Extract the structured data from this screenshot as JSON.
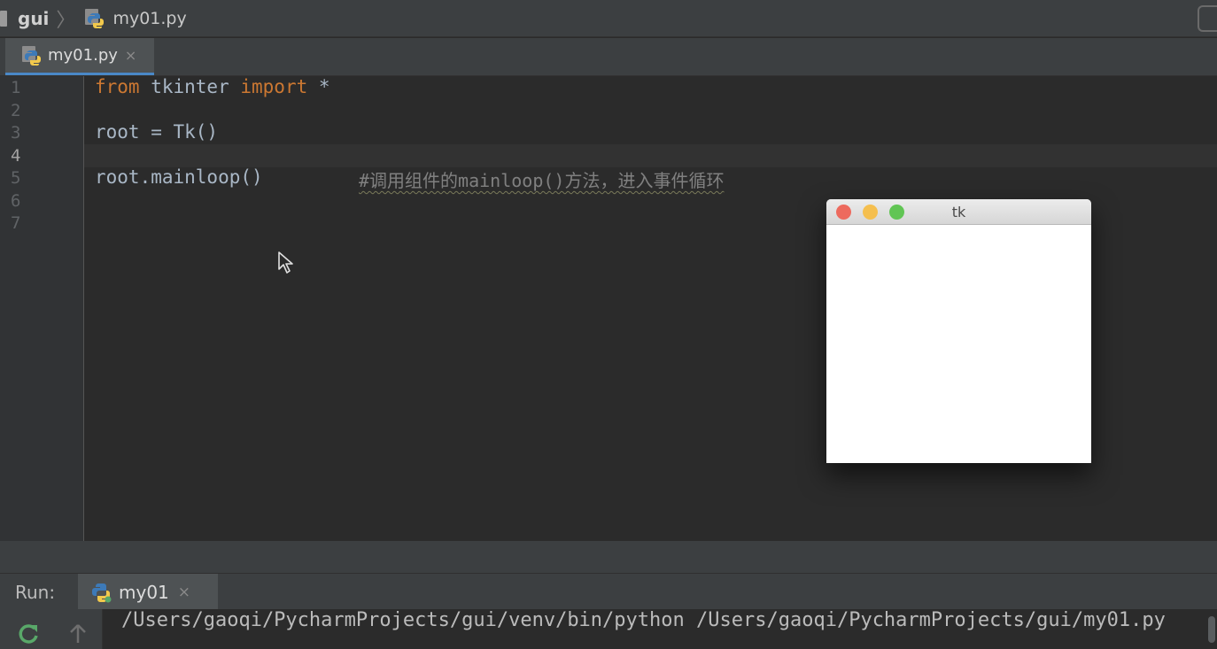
{
  "navbar": {
    "folder": "gui",
    "separator": "〉",
    "file": "my01.py",
    "file_icon": "python-file-icon"
  },
  "tabs": [
    {
      "label": "my01.py",
      "close": "×",
      "icon": "python-file-icon",
      "active": true
    }
  ],
  "editor": {
    "line_numbers": [
      "1",
      "2",
      "3",
      "4",
      "5",
      "6",
      "7"
    ],
    "current_line": "4",
    "code": {
      "line1": {
        "kw1": "from",
        "mod": " tkinter ",
        "kw2": "import",
        "rest": " *"
      },
      "line3": "root = Tk()",
      "line5_code": "root.mainloop()",
      "line5_comment": "#调用组件的mainloop()方法，进入事件循环"
    },
    "colors": {
      "keyword": "#cc7832",
      "text": "#a9b7c6",
      "comment": "#808080"
    }
  },
  "tk_window": {
    "title": "tk",
    "buttons": [
      "close",
      "minimize",
      "maximize"
    ]
  },
  "run_panel": {
    "label": "Run:",
    "tab_label": "my01",
    "tab_close": "×",
    "tab_icon": "python-run-icon",
    "console_line": "/Users/gaoqi/PycharmProjects/gui/venv/bin/python /Users/gaoqi/PycharmProjects/gui/my01.py",
    "tools": [
      "rerun-icon",
      "scroll-up-icon"
    ]
  }
}
